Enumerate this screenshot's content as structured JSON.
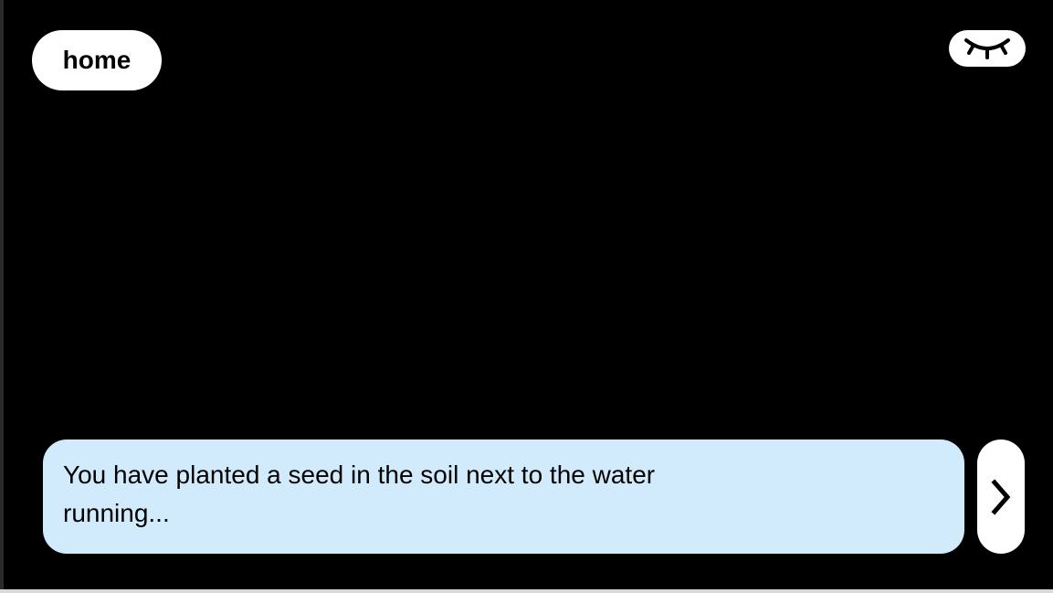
{
  "nav": {
    "home_label": "home"
  },
  "toggle": {
    "icon": "closed-eye-icon"
  },
  "dialog": {
    "text": "You have planted a seed in the soil next to the water running..."
  },
  "controls": {
    "next_icon": "chevron-right-icon"
  },
  "colors": {
    "background": "#000000",
    "dialog_bg": "#d2ebfc",
    "button_bg": "#ffffff"
  }
}
